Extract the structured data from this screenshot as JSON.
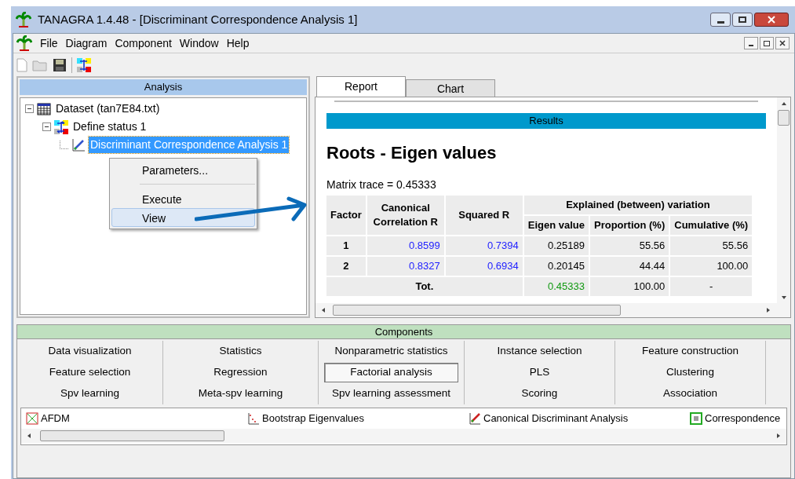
{
  "window": {
    "title": "TANAGRA 1.4.48 - [Discriminant Correspondence Analysis 1]"
  },
  "menu": [
    "File",
    "Diagram",
    "Component",
    "Window",
    "Help"
  ],
  "analysis": {
    "title": "Analysis",
    "tree": [
      {
        "label": "Dataset (tan7E84.txt)",
        "kind": "dataset",
        "expanded": true,
        "selected": false,
        "children": [
          {
            "label": "Define status 1",
            "kind": "status",
            "expanded": true,
            "selected": false,
            "children": [
              {
                "label": "Discriminant Correspondence Analysis 1",
                "kind": "analysis",
                "selected": true
              }
            ]
          }
        ]
      }
    ]
  },
  "context_menu": [
    {
      "label": "Parameters...",
      "kind": "item",
      "selected": false
    },
    {
      "kind": "separator"
    },
    {
      "label": "Execute",
      "kind": "item",
      "selected": false
    },
    {
      "label": "View",
      "kind": "item",
      "selected": true
    }
  ],
  "tabs": [
    {
      "label": "Report",
      "selected": true
    },
    {
      "label": "Chart",
      "selected": false
    }
  ],
  "report": {
    "banner": "Results",
    "heading": "Roots - Eigen values",
    "trace": "Matrix trace = 0.45333",
    "table": {
      "factor": "Factor",
      "canonical": "Canonical Correlation R",
      "squared": "Squared R",
      "group": "Explained (between) variation",
      "subcolumns": [
        "Eigen value",
        "Proportion (%)",
        "Cumulative (%)"
      ],
      "rows": [
        {
          "cells": [
            "1",
            "0.8599",
            "0.7394",
            "0.25189",
            "55.56",
            "55.56"
          ]
        },
        {
          "cells": [
            "2",
            "0.8327",
            "0.6934",
            "0.20145",
            "44.44",
            "100.00"
          ]
        }
      ],
      "total": {
        "label": "Tot.",
        "cells": [
          "0.45333",
          "100.00",
          "-"
        ]
      }
    }
  },
  "components": {
    "title": "Components",
    "categories": [
      {
        "label": "Data visualization",
        "selected": false
      },
      {
        "label": "Statistics",
        "selected": false
      },
      {
        "label": "Nonparametric statistics",
        "selected": false
      },
      {
        "label": "Instance selection",
        "selected": false
      },
      {
        "label": "Feature construction",
        "selected": false
      },
      {
        "label": "Feature selection",
        "selected": false
      },
      {
        "label": "Regression",
        "selected": false
      },
      {
        "label": "Factorial analysis",
        "selected": true
      },
      {
        "label": "PLS",
        "selected": false
      },
      {
        "label": "Clustering",
        "selected": false
      },
      {
        "label": "Spv learning",
        "selected": false
      },
      {
        "label": "Meta-spv learning",
        "selected": false
      },
      {
        "label": "Spv learning assessment",
        "selected": false
      },
      {
        "label": "Scoring",
        "selected": false
      },
      {
        "label": "Association",
        "selected": false
      }
    ],
    "items": [
      {
        "label": "AFDM",
        "kind": "grid"
      },
      {
        "label": "Bootstrap Eigenvalues",
        "kind": "scree"
      },
      {
        "label": "Canonical Discriminant Analysis",
        "kind": "wand"
      },
      {
        "label": "Correspondence",
        "kind": "square"
      }
    ]
  }
}
